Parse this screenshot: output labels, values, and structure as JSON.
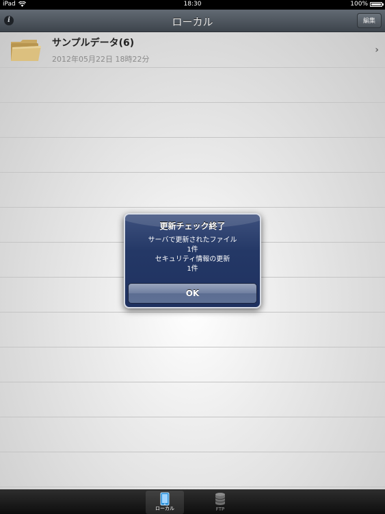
{
  "status_bar": {
    "device": "iPad",
    "time": "18:30",
    "battery": "100%"
  },
  "nav": {
    "title": "ローカル",
    "edit_label": "編集",
    "info_glyph": "i"
  },
  "list": {
    "items": [
      {
        "name": "サンプルデータ(6)",
        "date": "2012年05月22日 18時22分",
        "icon": "folder-icon"
      }
    ]
  },
  "alert": {
    "title": "更新チェック終了",
    "lines": [
      "サーバで更新されたファイル",
      "1件",
      "セキュリティ情報の更新",
      "1件"
    ],
    "ok_label": "OK"
  },
  "tabbar": {
    "tabs": [
      {
        "label": "ローカル",
        "icon": "ipad-icon",
        "active": true
      },
      {
        "label": "FTP",
        "icon": "database-icon",
        "active": false
      }
    ]
  },
  "colors": {
    "alert_blue": "#243866",
    "nav_gray": "#4d555d",
    "folder_tan": "#d9be7c"
  }
}
